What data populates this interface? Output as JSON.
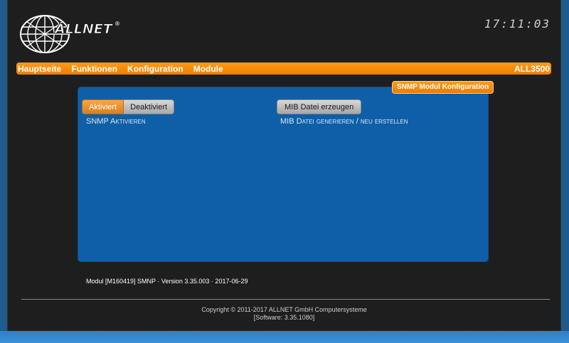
{
  "header": {
    "logo_text": "ALLNET",
    "logo_mark": "®",
    "clock": "17:11:03"
  },
  "nav": {
    "items": [
      "Hauptseite",
      "Funktionen",
      "Konfiguration",
      "Module"
    ],
    "device": "ALL3500"
  },
  "panel": {
    "title": "SNMP Modul Konfiguration",
    "toggle": {
      "on_label": "Aktiviert",
      "off_label": "Deaktiviert",
      "selected": "Aktiviert",
      "caption": "SNMP Aktivieren"
    },
    "mib": {
      "button_label": "MIB Datei erzeugen",
      "caption": "MIB Datei generieren / neu erstellen"
    }
  },
  "module_info": "Modul [M160419] SMNP · Version 3.35.003 · 2017-06-29",
  "footer": {
    "copyright": "Copyright © 2011-2017 ALLNET GmbH Computersysteme",
    "software": "[Software: 3.35.1080]"
  },
  "colors": {
    "accent": "#f07e00",
    "panel": "#0f5fa8",
    "background": "#1e1e1e"
  }
}
